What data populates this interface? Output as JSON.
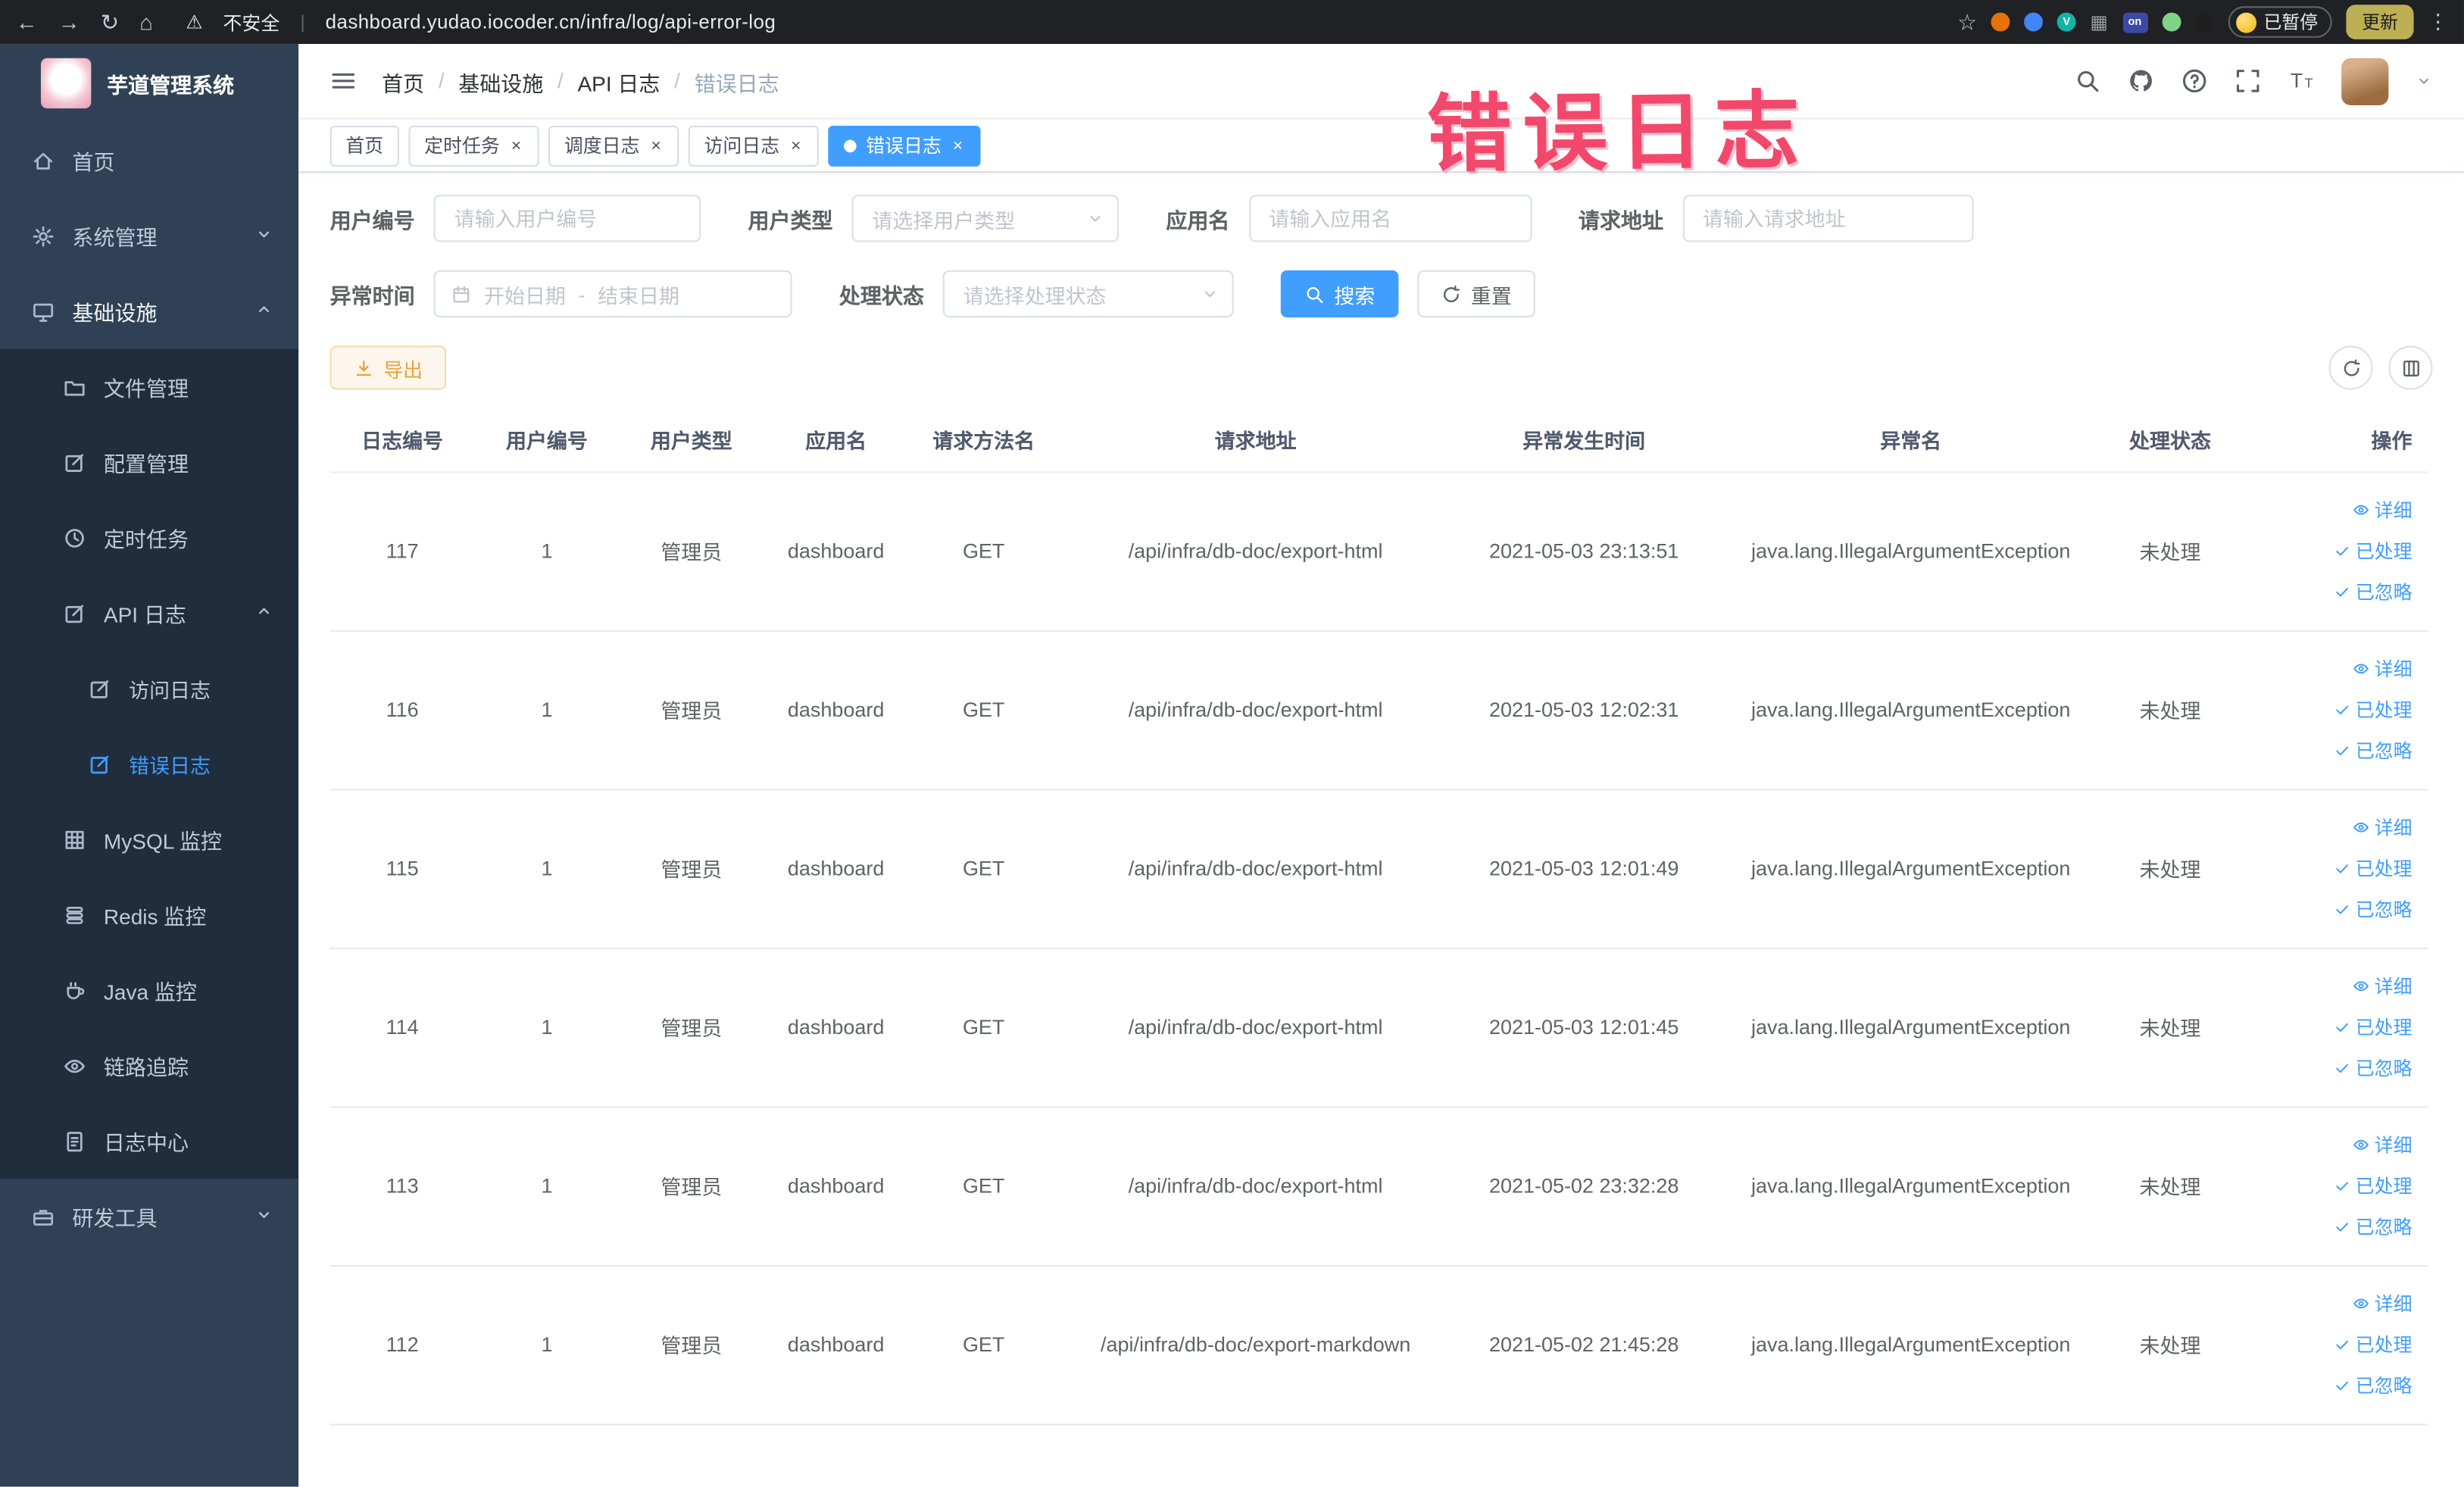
{
  "annotation": {
    "text": "错误日志",
    "color": "#f2486b"
  },
  "browser": {
    "security_label": "不安全",
    "url": "dashboard.yudao.iocoder.cn/infra/log/api-error-log",
    "ext_v": "V",
    "ext_on": "on",
    "paused_badge": "已暂停",
    "update_button": "更新"
  },
  "colors": {
    "accent": "#409eff",
    "warning": "#e6a23c",
    "sidebar_bg": "#304156",
    "submenu_bg": "#1f2d3d",
    "annotation": "#f2486b"
  },
  "sidebar": {
    "logo_title": "芋道管理系统",
    "items": [
      {
        "label": "首页",
        "icon": "home-icon",
        "level": 1
      },
      {
        "label": "系统管理",
        "icon": "gear-icon",
        "level": 1,
        "arrow": "down"
      },
      {
        "label": "基础设施",
        "icon": "infra-icon",
        "level": 1,
        "arrow": "up",
        "open": true
      },
      {
        "label": "文件管理",
        "icon": "folder-icon",
        "level": 2
      },
      {
        "label": "配置管理",
        "icon": "edit-icon",
        "level": 2
      },
      {
        "label": "定时任务",
        "icon": "clock-icon",
        "level": 2
      },
      {
        "label": "API 日志",
        "icon": "edit-icon",
        "level": 2,
        "arrow": "up"
      },
      {
        "label": "访问日志",
        "icon": "edit-icon",
        "level": 3
      },
      {
        "label": "错误日志",
        "icon": "edit-icon",
        "level": 3,
        "active": true
      },
      {
        "label": "MySQL 监控",
        "icon": "grid-icon",
        "level": 2
      },
      {
        "label": "Redis 监控",
        "icon": "coins-icon",
        "level": 2
      },
      {
        "label": "Java 监控",
        "icon": "coffee-icon",
        "level": 2
      },
      {
        "label": "链路追踪",
        "icon": "eye-icon",
        "level": 2
      },
      {
        "label": "日志中心",
        "icon": "doc-icon",
        "level": 2
      },
      {
        "label": "研发工具",
        "icon": "briefcase-icon",
        "level": 1,
        "arrow": "down"
      }
    ]
  },
  "header": {
    "breadcrumbs": [
      "首页",
      "基础设施",
      "API 日志",
      "错误日志"
    ]
  },
  "tabs": [
    {
      "label": "首页",
      "closable": false,
      "active": false
    },
    {
      "label": "定时任务",
      "closable": true,
      "active": false
    },
    {
      "label": "调度日志",
      "closable": true,
      "active": false
    },
    {
      "label": "访问日志",
      "closable": true,
      "active": false
    },
    {
      "label": "错误日志",
      "closable": true,
      "active": true
    }
  ],
  "filters": {
    "user_id": {
      "label": "用户编号",
      "placeholder": "请输入用户编号"
    },
    "user_type": {
      "label": "用户类型",
      "placeholder": "请选择用户类型"
    },
    "app_name": {
      "label": "应用名",
      "placeholder": "请输入应用名"
    },
    "request_url": {
      "label": "请求地址",
      "placeholder": "请输入请求地址"
    },
    "exception_time": {
      "label": "异常时间",
      "start_placeholder": "开始日期",
      "separator": "-",
      "end_placeholder": "结束日期"
    },
    "process_status": {
      "label": "处理状态",
      "placeholder": "请选择处理状态"
    },
    "search_button": "搜索",
    "reset_button": "重置"
  },
  "toolbar": {
    "export_button": "导出"
  },
  "table": {
    "columns": [
      "日志编号",
      "用户编号",
      "用户类型",
      "应用名",
      "请求方法名",
      "请求地址",
      "异常发生时间",
      "异常名",
      "处理状态",
      "操作"
    ],
    "actions": [
      "详细",
      "已处理",
      "已忽略"
    ],
    "rows": [
      {
        "id": "117",
        "user_id": "1",
        "user_type": "管理员",
        "app": "dashboard",
        "method": "GET",
        "url": "/api/infra/db-doc/export-html",
        "time": "2021-05-03 23:13:51",
        "exception": "java.lang.IllegalArgumentException",
        "status": "未处理"
      },
      {
        "id": "116",
        "user_id": "1",
        "user_type": "管理员",
        "app": "dashboard",
        "method": "GET",
        "url": "/api/infra/db-doc/export-html",
        "time": "2021-05-03 12:02:31",
        "exception": "java.lang.IllegalArgumentException",
        "status": "未处理"
      },
      {
        "id": "115",
        "user_id": "1",
        "user_type": "管理员",
        "app": "dashboard",
        "method": "GET",
        "url": "/api/infra/db-doc/export-html",
        "time": "2021-05-03 12:01:49",
        "exception": "java.lang.IllegalArgumentException",
        "status": "未处理"
      },
      {
        "id": "114",
        "user_id": "1",
        "user_type": "管理员",
        "app": "dashboard",
        "method": "GET",
        "url": "/api/infra/db-doc/export-html",
        "time": "2021-05-03 12:01:45",
        "exception": "java.lang.IllegalArgumentException",
        "status": "未处理"
      },
      {
        "id": "113",
        "user_id": "1",
        "user_type": "管理员",
        "app": "dashboard",
        "method": "GET",
        "url": "/api/infra/db-doc/export-html",
        "time": "2021-05-02 23:32:28",
        "exception": "java.lang.IllegalArgumentException",
        "status": "未处理"
      },
      {
        "id": "112",
        "user_id": "1",
        "user_type": "管理员",
        "app": "dashboard",
        "method": "GET",
        "url": "/api/infra/db-doc/export-markdown",
        "time": "2021-05-02 21:45:28",
        "exception": "java.lang.IllegalArgumentException",
        "status": "未处理"
      }
    ]
  }
}
